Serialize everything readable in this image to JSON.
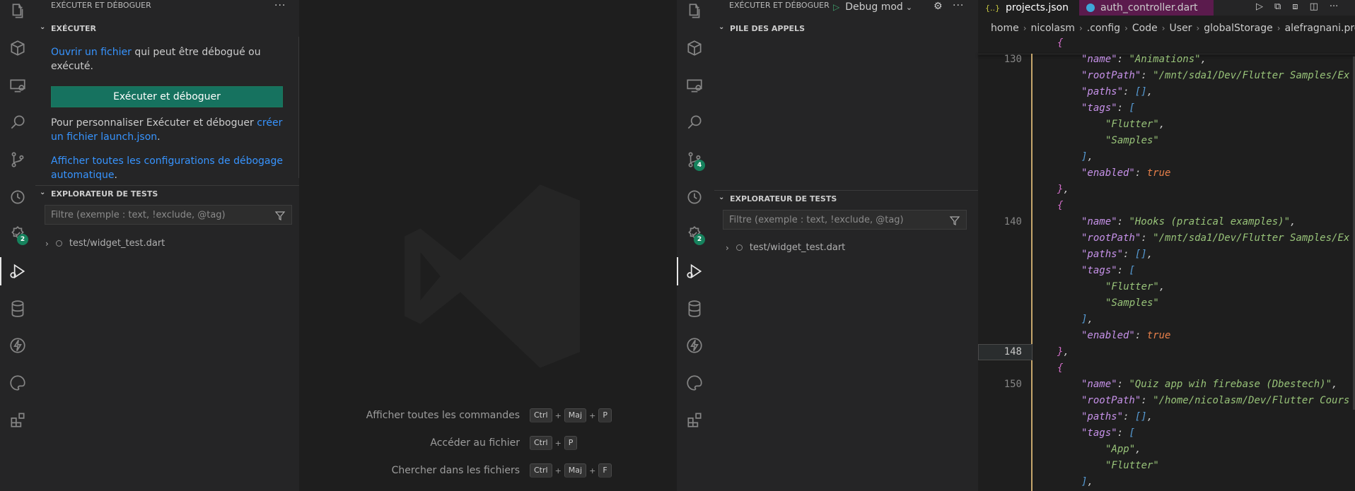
{
  "left": {
    "activity_badges": {
      "testing": "2"
    },
    "panel_title": "EXÉCUTER ET DÉBOGUER",
    "run_section": {
      "header": "EXÉCUTER",
      "open_file_link": "Ouvrir un fichier",
      "open_file_rest": " qui peut être débogué ou exécuté.",
      "run_button": "Exécuter et déboguer",
      "customize_text": "Pour personnaliser Exécuter et déboguer ",
      "create_link": "créer un fichier launch.json",
      "customize_end": ".",
      "show_all_link": "Afficher toutes les configurations de débogage automatique",
      "show_all_end": "."
    },
    "tests": {
      "header": "EXPLORATEUR DE TESTS",
      "filter_placeholder": "Filtre (exemple : text, !exclude, @tag)",
      "item": "test/widget_test.dart"
    }
  },
  "welcome": {
    "shortcuts": [
      {
        "label": "Afficher toutes les commandes",
        "keys": [
          "Ctrl",
          "Maj",
          "P"
        ]
      },
      {
        "label": "Accéder au fichier",
        "keys": [
          "Ctrl",
          "P"
        ]
      },
      {
        "label": "Chercher dans les fichiers",
        "keys": [
          "Ctrl",
          "Maj",
          "F"
        ]
      }
    ]
  },
  "right": {
    "activity_badges": {
      "git": "4",
      "testing": "2"
    },
    "panel_title": "EXÉCUTER ET DÉBOGUER",
    "debug_config": "Debug mod",
    "callstack_header": "PILE DES APPELS",
    "tests": {
      "header": "EXPLORATEUR DE TESTS",
      "filter_placeholder": "Filtre (exemple : text, !exclude, @tag)",
      "item": "test/widget_test.dart"
    }
  },
  "editor": {
    "tabs": [
      {
        "icon": "{..}",
        "label": "projects.json"
      },
      {
        "icon": "dart",
        "label": "auth_controller.dart"
      }
    ],
    "breadcrumb": [
      "home",
      "nicolasm",
      ".config",
      "Code",
      "User",
      "globalStorage",
      "alefragnani.project"
    ],
    "lines": [
      {
        "num": "",
        "tokens": [
          [
            "brc",
            "{"
          ]
        ],
        "indent": 0
      },
      {
        "num": "130",
        "tokens": [
          [
            "prop",
            "\"name\""
          ],
          [
            "pun",
            ": "
          ],
          [
            "str",
            "\"Animations\""
          ],
          [
            "pun",
            ","
          ]
        ],
        "indent": 1
      },
      {
        "num": "",
        "tokens": [
          [
            "prop",
            "\"rootPath\""
          ],
          [
            "pun",
            ": "
          ],
          [
            "str",
            "\"/mnt/sda1/Dev/Flutter Samples/Ex"
          ]
        ],
        "indent": 1
      },
      {
        "num": "",
        "tokens": [
          [
            "prop",
            "\"paths\""
          ],
          [
            "pun",
            ": "
          ],
          [
            "brk",
            "[]"
          ],
          [
            "pun",
            ","
          ]
        ],
        "indent": 1
      },
      {
        "num": "",
        "tokens": [
          [
            "prop",
            "\"tags\""
          ],
          [
            "pun",
            ": "
          ],
          [
            "brk",
            "["
          ]
        ],
        "indent": 1
      },
      {
        "num": "",
        "tokens": [
          [
            "str",
            "\"Flutter\""
          ],
          [
            "pun",
            ","
          ]
        ],
        "indent": 2
      },
      {
        "num": "",
        "tokens": [
          [
            "str",
            "\"Samples\""
          ]
        ],
        "indent": 2
      },
      {
        "num": "",
        "tokens": [
          [
            "brk",
            "]"
          ],
          [
            "pun",
            ","
          ]
        ],
        "indent": 1
      },
      {
        "num": "",
        "tokens": [
          [
            "prop",
            "\"enabled\""
          ],
          [
            "pun",
            ": "
          ],
          [
            "tru",
            "true"
          ]
        ],
        "indent": 1
      },
      {
        "num": "",
        "tokens": [
          [
            "brc",
            "}"
          ],
          [
            "pun",
            ","
          ]
        ],
        "indent": 0
      },
      {
        "num": "",
        "tokens": [
          [
            "brc",
            "{"
          ]
        ],
        "indent": 0
      },
      {
        "num": "140",
        "tokens": [
          [
            "prop",
            "\"name\""
          ],
          [
            "pun",
            ": "
          ],
          [
            "str",
            "\"Hooks (pratical examples)\""
          ],
          [
            "pun",
            ","
          ]
        ],
        "indent": 1
      },
      {
        "num": "",
        "tokens": [
          [
            "prop",
            "\"rootPath\""
          ],
          [
            "pun",
            ": "
          ],
          [
            "str",
            "\"/mnt/sda1/Dev/Flutter Samples/Ex"
          ]
        ],
        "indent": 1
      },
      {
        "num": "",
        "tokens": [
          [
            "prop",
            "\"paths\""
          ],
          [
            "pun",
            ": "
          ],
          [
            "brk",
            "[]"
          ],
          [
            "pun",
            ","
          ]
        ],
        "indent": 1
      },
      {
        "num": "",
        "tokens": [
          [
            "prop",
            "\"tags\""
          ],
          [
            "pun",
            ": "
          ],
          [
            "brk",
            "["
          ]
        ],
        "indent": 1
      },
      {
        "num": "",
        "tokens": [
          [
            "str",
            "\"Flutter\""
          ],
          [
            "pun",
            ","
          ]
        ],
        "indent": 2
      },
      {
        "num": "",
        "tokens": [
          [
            "str",
            "\"Samples\""
          ]
        ],
        "indent": 2
      },
      {
        "num": "",
        "tokens": [
          [
            "brk",
            "]"
          ],
          [
            "pun",
            ","
          ]
        ],
        "indent": 1
      },
      {
        "num": "",
        "tokens": [
          [
            "prop",
            "\"enabled\""
          ],
          [
            "pun",
            ": "
          ],
          [
            "tru",
            "true"
          ]
        ],
        "indent": 1
      },
      {
        "num": "148",
        "tokens": [
          [
            "brc",
            "}"
          ],
          [
            "pun",
            ","
          ]
        ],
        "indent": 0,
        "current": true
      },
      {
        "num": "",
        "tokens": [
          [
            "brc",
            "{"
          ]
        ],
        "indent": 0
      },
      {
        "num": "150",
        "tokens": [
          [
            "prop",
            "\"name\""
          ],
          [
            "pun",
            ": "
          ],
          [
            "str",
            "\"Quiz app wih firebase (Dbestech)\""
          ],
          [
            "pun",
            ","
          ]
        ],
        "indent": 1
      },
      {
        "num": "",
        "tokens": [
          [
            "prop",
            "\"rootPath\""
          ],
          [
            "pun",
            ": "
          ],
          [
            "str",
            "\"/home/nicolasm/Dev/Flutter Cours"
          ]
        ],
        "indent": 1
      },
      {
        "num": "",
        "tokens": [
          [
            "prop",
            "\"paths\""
          ],
          [
            "pun",
            ": "
          ],
          [
            "brk",
            "[]"
          ],
          [
            "pun",
            ","
          ]
        ],
        "indent": 1
      },
      {
        "num": "",
        "tokens": [
          [
            "prop",
            "\"tags\""
          ],
          [
            "pun",
            ": "
          ],
          [
            "brk",
            "["
          ]
        ],
        "indent": 1
      },
      {
        "num": "",
        "tokens": [
          [
            "str",
            "\"App\""
          ],
          [
            "pun",
            ","
          ]
        ],
        "indent": 2
      },
      {
        "num": "",
        "tokens": [
          [
            "str",
            "\"Flutter\""
          ]
        ],
        "indent": 2
      },
      {
        "num": "",
        "tokens": [
          [
            "brk",
            "]"
          ],
          [
            "pun",
            ","
          ]
        ],
        "indent": 1
      }
    ]
  }
}
